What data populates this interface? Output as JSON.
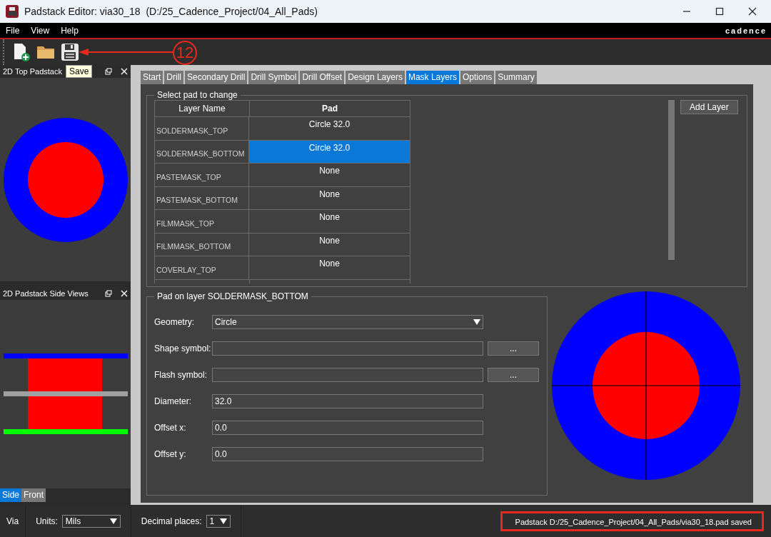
{
  "window": {
    "title": "Padstack Editor: via30_18  (D:/25_Cadence_Project/04_All_Pads)"
  },
  "menu": [
    "File",
    "View",
    "Help"
  ],
  "brand": "cadence",
  "tooltip": "Save",
  "annotation": {
    "label": "12"
  },
  "panels": [
    {
      "title": "2D Top Padstack"
    },
    {
      "title": "2D Padstack Side Views"
    }
  ],
  "view_tabs": [
    {
      "label": "Side",
      "selected": true
    },
    {
      "label": "Front",
      "selected": false
    }
  ],
  "tabs": [
    {
      "label": "Start",
      "selected": false
    },
    {
      "label": "Drill",
      "selected": false
    },
    {
      "label": "Secondary Drill",
      "selected": false
    },
    {
      "label": "Drill Symbol",
      "selected": false
    },
    {
      "label": "Drill Offset",
      "selected": false
    },
    {
      "label": "Design Layers",
      "selected": false
    },
    {
      "label": "Mask Layers",
      "selected": true
    },
    {
      "label": "Options",
      "selected": false
    },
    {
      "label": "Summary",
      "selected": false
    }
  ],
  "layer_table": {
    "title": "Select pad to change",
    "columns": [
      "Layer Name",
      "Pad"
    ],
    "rows": [
      {
        "layer": "SOLDERMASK_TOP",
        "pad": "Circle 32.0",
        "selected": false
      },
      {
        "layer": "SOLDERMASK_BOTTOM",
        "pad": "Circle 32.0",
        "selected": true
      },
      {
        "layer": "PASTEMASK_TOP",
        "pad": "None",
        "selected": false
      },
      {
        "layer": "PASTEMASK_BOTTOM",
        "pad": "None",
        "selected": false
      },
      {
        "layer": "FILMMASK_TOP",
        "pad": "None",
        "selected": false
      },
      {
        "layer": "FILMMASK_BOTTOM",
        "pad": "None",
        "selected": false
      },
      {
        "layer": "COVERLAY_TOP",
        "pad": "None",
        "selected": false
      }
    ]
  },
  "add_layer_button": "Add Layer",
  "pad_form": {
    "title": "Pad on layer SOLDERMASK_BOTTOM",
    "fields": [
      {
        "kind": "dropdown",
        "label": "Geometry:",
        "value": "Circle"
      },
      {
        "kind": "browse",
        "label": "Shape symbol:",
        "button": "..."
      },
      {
        "kind": "browse",
        "label": "Flash symbol:",
        "button": "..."
      },
      {
        "kind": "text",
        "label": "Diameter:",
        "value": "32.0"
      },
      {
        "kind": "text",
        "label": "Offset x:",
        "value": "0.0"
      },
      {
        "kind": "text",
        "label": "Offset y:",
        "value": "0.0"
      }
    ]
  },
  "status_bar": {
    "mode": "Via",
    "units_label": "Units:",
    "units": "Mils",
    "decimals_label": "Decimal places:",
    "decimals": "1",
    "message": "Padstack D:/25_Cadence_Project/04_All_Pads/via30_18.pad saved",
    "highlighted": true
  }
}
